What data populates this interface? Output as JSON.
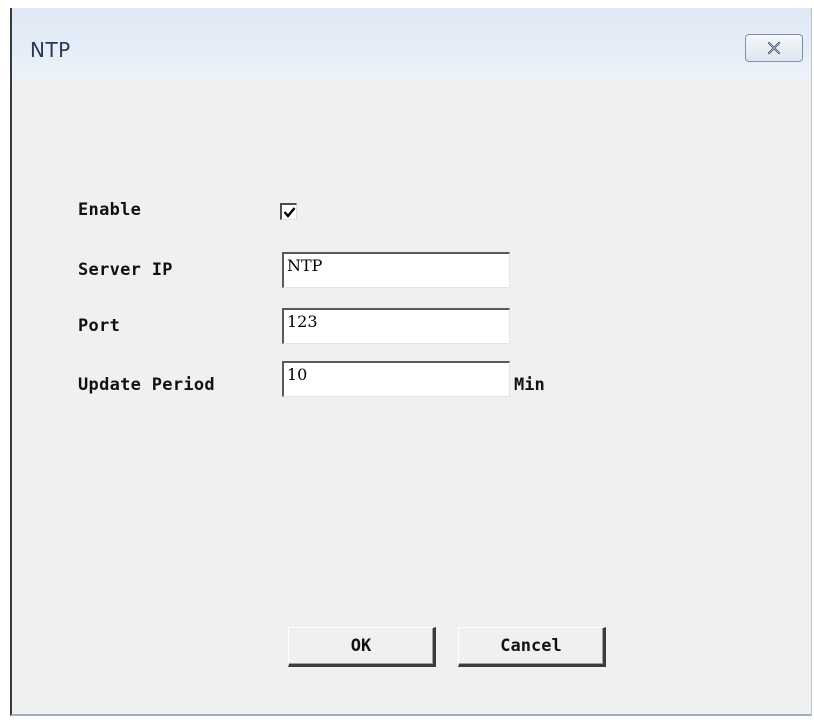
{
  "window": {
    "title": "NTP",
    "close_icon": "close-icon"
  },
  "form": {
    "enable_label": "Enable",
    "enable_checked": true,
    "server_ip_label": "Server IP",
    "server_ip_value": "NTP",
    "port_label": "Port",
    "port_value": "123",
    "update_period_label": "Update Period",
    "update_period_value": "10",
    "update_period_unit": "Min"
  },
  "buttons": {
    "ok_label": "OK",
    "cancel_label": "Cancel"
  }
}
